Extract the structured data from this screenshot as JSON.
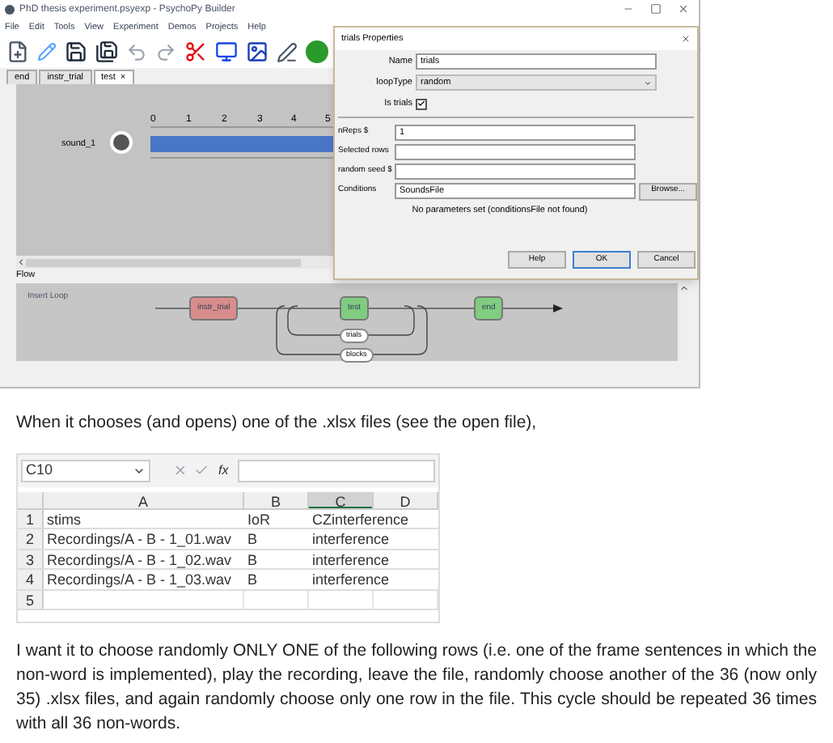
{
  "builder": {
    "title": "PhD thesis experiment.psyexp - PsychoPy Builder",
    "menu": [
      "File",
      "Edit",
      "Tools",
      "View",
      "Experiment",
      "Demos",
      "Projects",
      "Help"
    ],
    "tabs": [
      {
        "label": "end",
        "selected": false
      },
      {
        "label": "instr_trial",
        "selected": false
      },
      {
        "label": "test",
        "selected": true,
        "close": "×"
      }
    ],
    "routine": {
      "component": "sound_1",
      "ticks": [
        "0",
        "1",
        "2",
        "3",
        "4",
        "5"
      ]
    },
    "flow": {
      "title": "Flow",
      "insert_loop": "Insert Loop",
      "routines": [
        {
          "label": "instr_trial",
          "color": "#d98c8c"
        },
        {
          "label": "test",
          "color": "#80cc80"
        },
        {
          "label": "end",
          "color": "#80cc80"
        }
      ],
      "loops": [
        "trials",
        "blocks"
      ]
    }
  },
  "dialog": {
    "title": "trials Properties",
    "fields": [
      {
        "kind": "text",
        "label": "Name",
        "value": "trials"
      },
      {
        "kind": "select",
        "label": "loopType",
        "value": "random"
      },
      {
        "kind": "checkbox",
        "label": "Is trials",
        "checked": true
      }
    ],
    "params": [
      {
        "label": "nReps $",
        "value": "1"
      },
      {
        "label": "Selected rows"
      },
      {
        "label": "random seed $"
      },
      {
        "label": "Conditions",
        "value": "SoundsFile",
        "button": "Browse..."
      }
    ],
    "message": "No parameters set (conditionsFile not found)",
    "buttons": [
      "Help",
      "OK",
      "Cancel"
    ]
  },
  "caption": "When it chooses (and opens) one of the .xlsx files (see the open file),",
  "sheet": {
    "name_box": "C10",
    "function_label": "fx",
    "columns": [
      {
        "label": "A",
        "selected": false
      },
      {
        "label": "B",
        "selected": false
      },
      {
        "label": "C",
        "selected": true
      },
      {
        "label": "D",
        "selected": false
      }
    ],
    "rows": [
      {
        "number": "1",
        "cells": [
          "stims",
          "IoR",
          "CZinterference"
        ]
      },
      {
        "number": "2",
        "cells": [
          "Recordings/A - B - 1_01.wav",
          "B",
          "interference"
        ]
      },
      {
        "number": "3",
        "cells": [
          "Recordings/A - B - 1_02.wav",
          "B",
          "interference"
        ]
      },
      {
        "number": "4",
        "cells": [
          "Recordings/A - B - 1_03.wav",
          "B",
          "interference"
        ]
      },
      {
        "number": "5",
        "cells": []
      }
    ]
  },
  "paragraph": "I want it to choose randomly ONLY ONE of the following rows (i.e. one of the frame sentences in which the non-word is implemented), play the recording, leave the file, randomly choose another of the 36 (now only 35) .xlsx files, and again randomly choose only one row in the file. This cycle should be repeated 36 times with all 36 non-words."
}
